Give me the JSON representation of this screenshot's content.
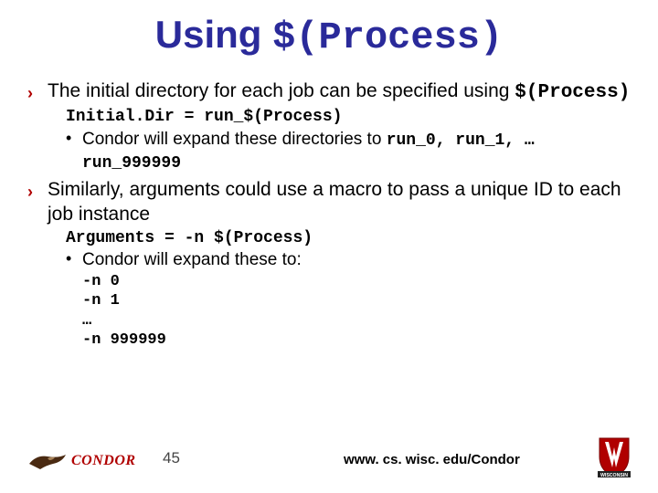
{
  "title_prefix": "Using ",
  "title_mono": "$(Process)",
  "bullets": [
    {
      "text_a": "The initial directory for each job can be specified using ",
      "mono_a": "$(Process)",
      "code": "Initial.Dir = run_$(Process)",
      "dot_text_a": "Condor will expand these directories to ",
      "dot_mono_seq": "run_0, run_1, … run_999999"
    },
    {
      "text_a": "Similarly, arguments could use a macro to pass a unique ID to each job instance",
      "code": "Arguments = -n $(Process)",
      "dot_text_a": "Condor will expand these to: ",
      "expanded": [
        "-n 0",
        "-n 1",
        "…",
        "-n 999999"
      ]
    }
  ],
  "footer": {
    "condor_label": "ONDOR",
    "slide_number": "45",
    "url": "www. cs. wisc. edu/Condor",
    "wisc_label": "WISCONSIN"
  }
}
